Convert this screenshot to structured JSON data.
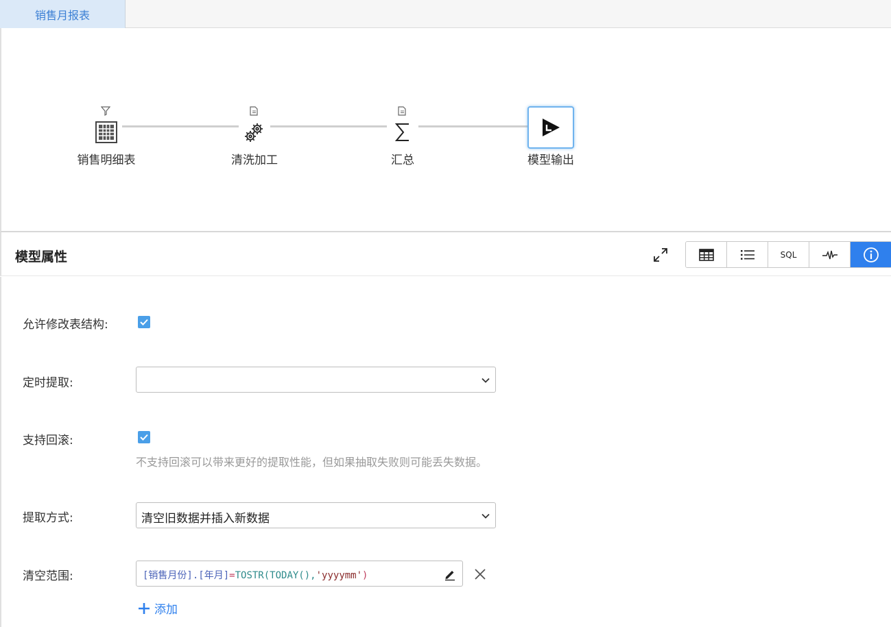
{
  "tabs": [
    {
      "label": "销售月报表",
      "active": true
    }
  ],
  "flow": {
    "nodes": [
      {
        "label": "销售明细表",
        "icon": "table-icon",
        "badge": "filter-icon"
      },
      {
        "label": "清洗加工",
        "icon": "gears-icon",
        "badge": "document-icon"
      },
      {
        "label": "汇总",
        "icon": "sigma-icon",
        "badge": "document-icon"
      },
      {
        "label": "模型输出",
        "icon": "output-play-icon",
        "selected": true
      }
    ]
  },
  "properties": {
    "title": "模型属性",
    "toolbar": [
      "table-view-icon",
      "list-view-icon",
      "SQL",
      "pulse-icon",
      "info-icon"
    ],
    "sql_label": "SQL",
    "active_tool": "info-icon"
  },
  "form": {
    "allow_modify": {
      "label": "允许修改表结构:",
      "checked": true
    },
    "scheduled_extract": {
      "label": "定时提取:",
      "value": ""
    },
    "support_rollback": {
      "label": "支持回滚:",
      "checked": true,
      "hint": "不支持回滚可以带来更好的提取性能，但如果抽取失败则可能丢失数据。"
    },
    "extract_mode": {
      "label": "提取方式:",
      "value": "清空旧数据并插入新数据"
    },
    "clear_range": {
      "label": "清空范围:",
      "expression": {
        "field": "[销售月份].[年月]",
        "op": "=",
        "fn": "TOSTR(TODAY(),",
        "str": "'yyyymm'",
        "close": ")"
      },
      "add_label": "添加"
    }
  },
  "colors": {
    "accent": "#2f80ed",
    "checkbox": "#4a9fe8",
    "tab_bg": "#dbe9f8",
    "node_selected_border": "#6fb3ee"
  }
}
